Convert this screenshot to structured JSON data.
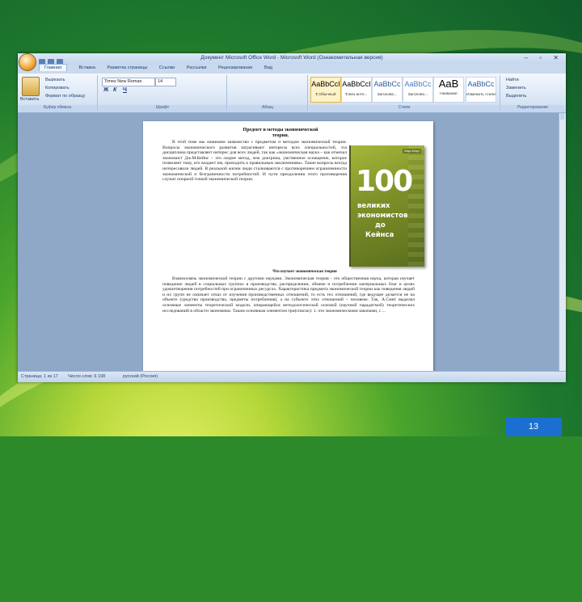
{
  "window": {
    "title": "Документ Microsoft Office Word - Microsoft Word (Ознакомительная версия)",
    "controls": "– ▫ ✕"
  },
  "tabs": [
    "Главная",
    "Вставка",
    "Разметка страницы",
    "Ссылки",
    "Рассылки",
    "Рецензирование",
    "Вид"
  ],
  "ribbon": {
    "clipboard": {
      "paste": "Вставить",
      "cut": "Вырезать",
      "copy": "Копировать",
      "format_painter": "Формат по образцу",
      "label": "Буфер обмена"
    },
    "font": {
      "name": "Times New Roman",
      "size": "14",
      "label": "Шрифт",
      "bold": "Ж",
      "italic": "К",
      "underline": "Ч"
    },
    "paragraph": {
      "label": "Абзац"
    },
    "styles": {
      "label": "Стили",
      "items": [
        {
          "sample": "AaBbCcI",
          "name": "¶ Обычный"
        },
        {
          "sample": "AaBbCcI",
          "name": "¶ Без инте..."
        },
        {
          "sample": "AaBbCc",
          "name": "Заголово..."
        },
        {
          "sample": "AaBbCc",
          "name": "Заголово..."
        },
        {
          "sample": "AaB",
          "name": "Название"
        },
        {
          "sample": "AaBbCc",
          "name": "Изменить стили"
        }
      ]
    },
    "editing": {
      "find": "Найти",
      "replace": "Заменить",
      "select": "Выделить",
      "label": "Редактирование"
    }
  },
  "document": {
    "title1": "Предмет и методы экономической",
    "title1b": "теории.",
    "para1": "В этой теме мы начинаем знакомство с предметом и методом экономической теории. Вопросы экономического развития затрагивают интересы всех специальностей, эта дисциплина представляет интерес для всех людей, так как «экономическая наука – как отмечал экономист Дж.М.Кейнс – это скорее метод, чем доктрина, умственное оснащение, которое позволяет тому, кто владеет им, приходить к правильным заключениям». Такие вопросы всегда интересовали людей. В реальной жизни люди сталкиваются с противоречием ограниченности экономической и безграничности потребностей. И пути преодоления этого противоречия служат опорной точкой экономической теории.",
    "title2": "Что изучает экономическая теория",
    "para2": "Взаимосвязь экономической теории с другими науками. Экономическая теория - это общественная наука, которая изучает поведение людей в социальных группах в производстве, распределении, обмене и потреблении материальных благ в целях удовлетворения потребностей при ограниченных ресурсах. Характеристика предмета экономической теории как поведения людей и их групп не означает отказ от изучения производственных отношений, то есть тех отношений, где ведущее делается не на объекте (средства производства, предметы потребления), а на субъекте этих отношений – человеке. Так, А.Смит выделял основные элементы теоретической модели, опирающейся методологической основой (научной парадигмой) теоретических исследований в области экономики. Таким основным элементом три(список): 1. что экономическими законами, с ..."
  },
  "book": {
    "author": "Марк Блауг",
    "number": "100",
    "line1": "великих",
    "line2": "экономистов",
    "line3": "до",
    "line4": "Кейнса"
  },
  "status": {
    "page": "Страница: 1 из 17",
    "words": "Число слов: 6 198",
    "lang": "русский (Россия)"
  },
  "slide_number": "13"
}
